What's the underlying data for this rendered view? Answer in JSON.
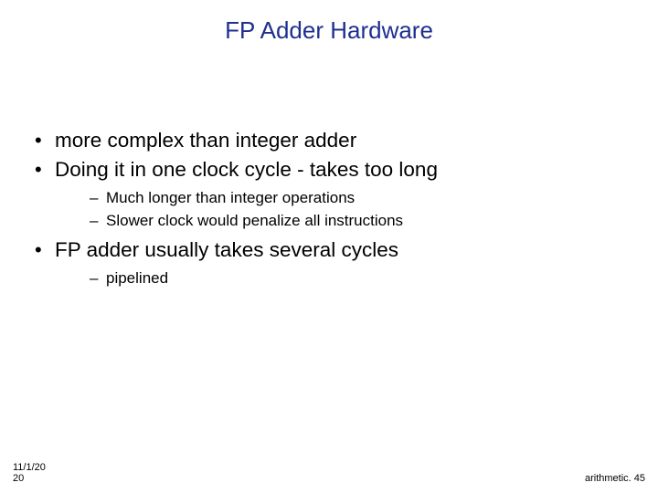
{
  "title": "FP Adder Hardware",
  "bullets": {
    "b0": "more complex than integer adder",
    "b1": "Doing it in one clock cycle - takes too long",
    "b1_sub0": "Much longer than integer operations",
    "b1_sub1": "Slower clock would penalize all instructions",
    "b2": "FP adder usually takes several cycles",
    "b2_sub0": " pipelined"
  },
  "footer": {
    "date": "11/1/20\n20",
    "page": "arithmetic. 45"
  },
  "colors": {
    "title": "#1f2f8f",
    "text": "#000000",
    "background": "#ffffff"
  }
}
